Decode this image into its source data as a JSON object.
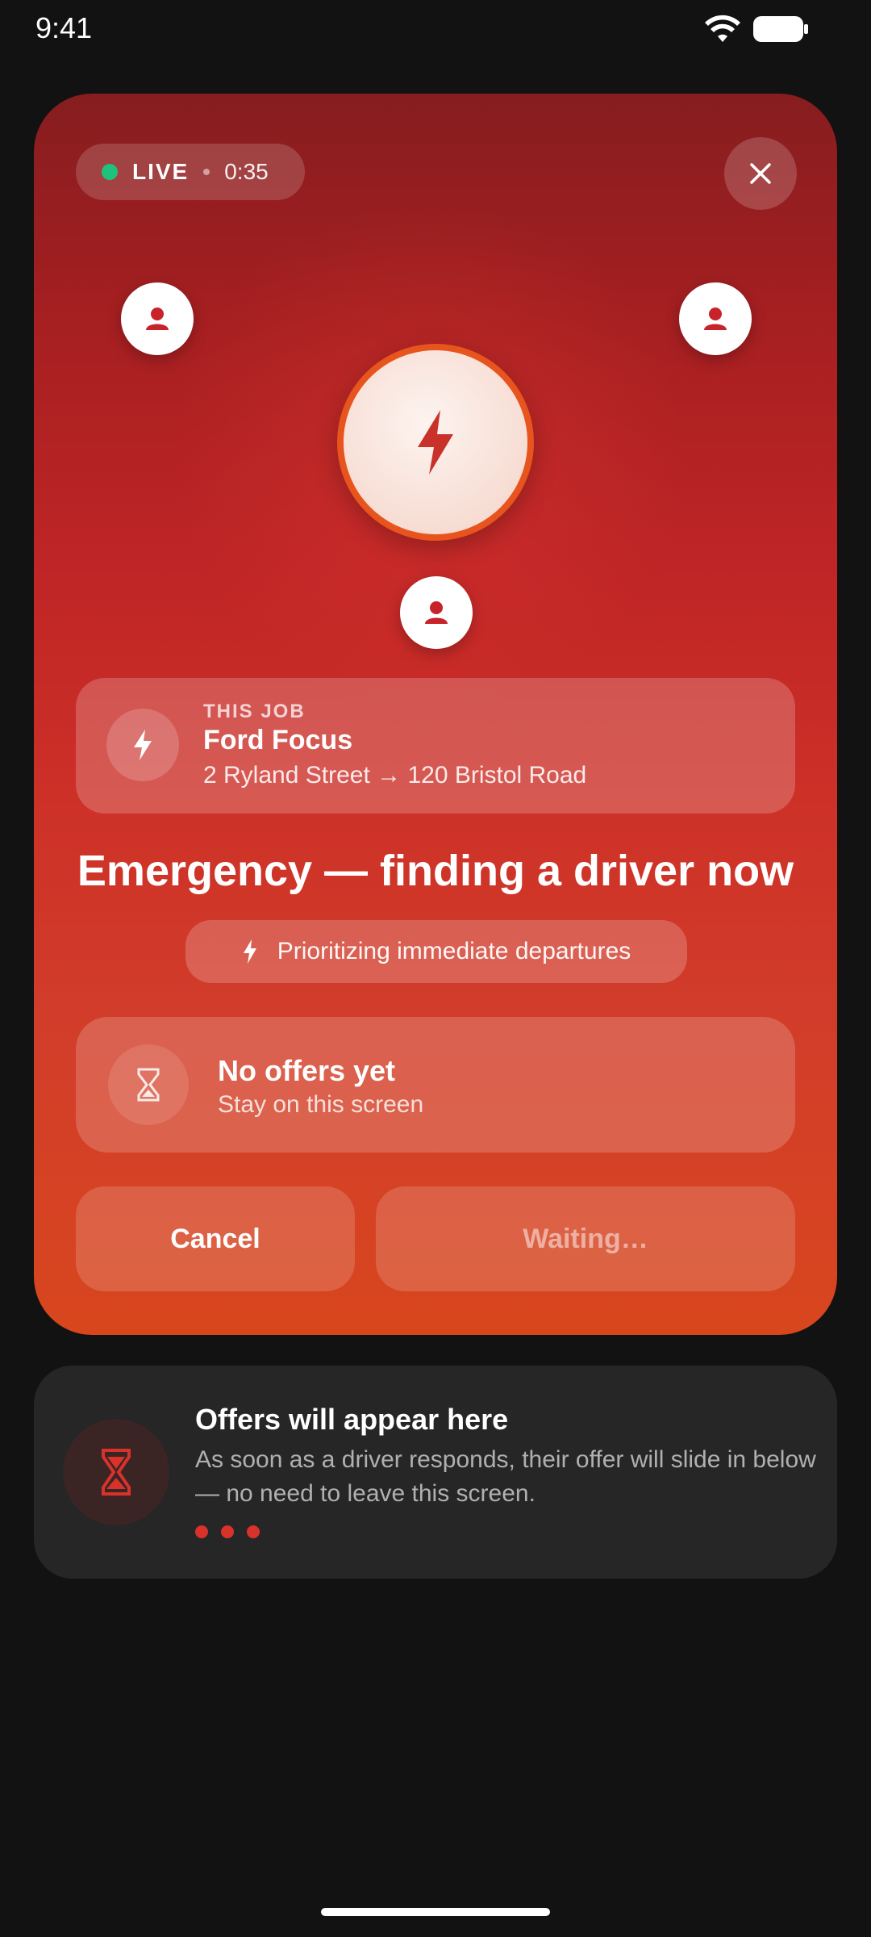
{
  "status_bar": {
    "time": "9:41"
  },
  "session": {
    "live_label": "LIVE",
    "timer": "0:35"
  },
  "icons": {
    "close": "close-icon",
    "driver": "person-icon",
    "center": "lightning-icon",
    "hourglass": "hourglass-icon"
  },
  "job": {
    "overline": "THIS JOB",
    "vehicle": "Ford Focus",
    "route": "2 Ryland Street → 120 Bristol Road"
  },
  "headline": "Emergency — finding a driver now",
  "priority": "Prioritizing immediate departures",
  "offers_status": {
    "title": "No offers yet",
    "subtitle": "Stay on this screen"
  },
  "buttons": {
    "cancel": "Cancel",
    "waiting": "Waiting…"
  },
  "offers_card": {
    "title": "Offers will appear here",
    "body": "As soon as a driver responds, their offer will slide in below — no need to leave this screen."
  },
  "colors": {
    "accent_red": "#c8232a",
    "live_green": "#1fc27a",
    "ring_orange": "#e8541d",
    "background": "#121212"
  }
}
